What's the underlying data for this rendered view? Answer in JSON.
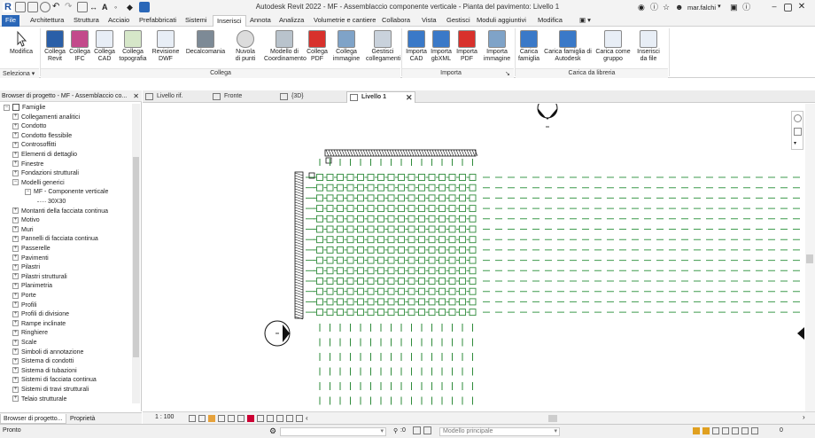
{
  "window": {
    "title": "Autodesk Revit 2022 - MF - Assemblaccio componente verticale - Pianta del pavimento: Livello 1",
    "user": "mar.falchi"
  },
  "tabs": [
    "File",
    "Architettura",
    "Struttura",
    "Acciaio",
    "Prefabbricati",
    "Sistemi",
    "Inserisci",
    "Annota",
    "Analizza",
    "Volumetrie e cantiere",
    "Collabora",
    "Vista",
    "Gestisci",
    "Moduli aggiuntivi",
    "Modifica"
  ],
  "ribbon": {
    "modifica": [
      "Modifica"
    ],
    "collega": [
      [
        "Collega",
        "Revit"
      ],
      [
        "Collega",
        "IFC"
      ],
      [
        "Collega",
        "CAD"
      ],
      [
        "Collega",
        "topografia"
      ],
      [
        "Revisione",
        "DWF"
      ],
      [
        "Decalcomania",
        ""
      ],
      [
        "Nuvola",
        "di punti"
      ],
      [
        "Modello di",
        "Coordinamento"
      ],
      [
        "Collega",
        "PDF"
      ],
      [
        "Collega",
        "immagine"
      ],
      [
        "Gestisci",
        "collegamenti"
      ]
    ],
    "importa": [
      [
        "Importa",
        "CAD"
      ],
      [
        "Importa",
        "gbXML"
      ],
      [
        "Importa",
        "PDF"
      ],
      [
        "Importa",
        "immagine"
      ]
    ],
    "libreria": [
      [
        "Carica",
        "famiglia"
      ],
      [
        "Carica famiglia di",
        "Autodesk"
      ],
      [
        "Carica come",
        "gruppo"
      ],
      [
        "Inserisci",
        "da file"
      ]
    ],
    "panels": {
      "selection": "Seleziona",
      "collega": "Collega",
      "importa": "Importa",
      "libreria": "Carica da libreria"
    }
  },
  "browser": {
    "header": "Browser di progetto - MF - Assemblaccio co...",
    "root": "Famiglie",
    "items": [
      "Collegamenti analitici",
      "Condotto",
      "Condotto flessibile",
      "Controsoffitti",
      "Elementi di dettaglio",
      "Finestre",
      "Fondazioni strutturali",
      "Modelli generici",
      "MF - Componente verticale",
      "30X30",
      "Montanti della facciata continua",
      "Motivo",
      "Muri",
      "Pannelli di facciata continua",
      "Passerelle",
      "Pavimenti",
      "Pilastri",
      "Pilastri strutturali",
      "Planimetria",
      "Porte",
      "Profili",
      "Profili di divisione",
      "Rampe inclinate",
      "Ringhiere",
      "Scale",
      "Simboli di annotazione",
      "Sistema di condotti",
      "Sistema di tubazioni",
      "Sistemi di facciata continua",
      "Sistemi di travi strutturali",
      "Telaio strutturale"
    ],
    "tabs": [
      "Browser di progetto...",
      "Proprietà"
    ]
  },
  "views": [
    "Livello rif.",
    "Fronte",
    "{3D}",
    "Livello 1"
  ],
  "status": {
    "left": "Pronto",
    "scale": "1 : 100",
    "selection_count": ":0",
    "model": "Modello principale",
    "filter": "0"
  },
  "colors": {
    "file_tab": "#2a67b8",
    "grid_green": "#2e8b3a",
    "dash_green": "#3e9a4d",
    "element_black": "#111111"
  }
}
